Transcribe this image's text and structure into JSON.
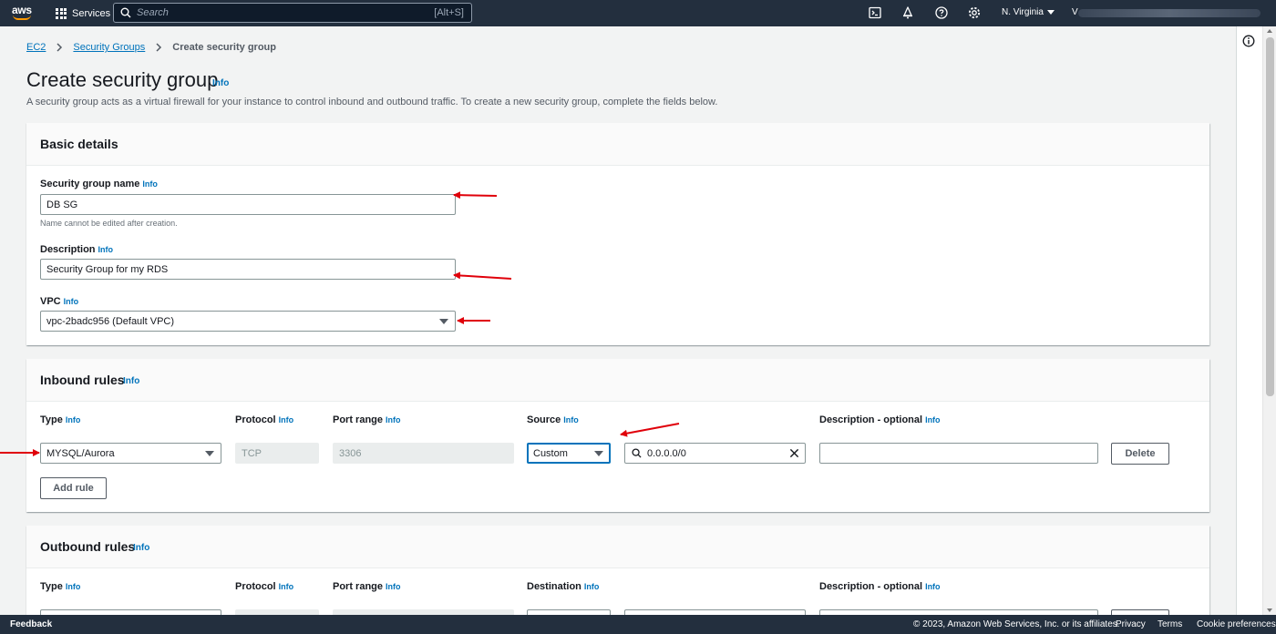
{
  "topbar": {
    "logo": "aws",
    "services_label": "Services",
    "search_placeholder": "Search",
    "search_shortcut": "[Alt+S]",
    "region": "N. Virginia",
    "account_initial": "V"
  },
  "breadcrumb": {
    "items": [
      "EC2",
      "Security Groups"
    ],
    "current": "Create security group"
  },
  "page": {
    "title": "Create security group",
    "title_info": "Info",
    "description": "A security group acts as a virtual firewall for your instance to control inbound and outbound traffic. To create a new security group, complete the fields below."
  },
  "basic": {
    "title": "Basic details",
    "name_label": "Security group name",
    "name_info": "Info",
    "name_value": "DB SG",
    "name_hint": "Name cannot be edited after creation.",
    "desc_label": "Description",
    "desc_info": "Info",
    "desc_value": "Security Group for my RDS",
    "vpc_label": "VPC",
    "vpc_info": "Info",
    "vpc_value": "vpc-2badc956 (Default VPC)"
  },
  "inbound": {
    "title": "Inbound rules",
    "title_info": "Info",
    "col_type": "Type",
    "col_protocol": "Protocol",
    "col_port": "Port range",
    "col_source": "Source",
    "col_desc": "Description - optional",
    "info": "Info",
    "type_value": "MYSQL/Aurora",
    "protocol_value": "TCP",
    "port_value": "3306",
    "source_select": "Custom",
    "source_cidr": "0.0.0.0/0",
    "description_value": "",
    "delete_label": "Delete",
    "add_rule_label": "Add rule"
  },
  "outbound": {
    "title": "Outbound rules",
    "title_info": "Info",
    "col_type": "Type",
    "col_protocol": "Protocol",
    "col_port": "Port range",
    "col_dest": "Destination",
    "col_desc": "Description - optional",
    "info": "Info"
  },
  "footer": {
    "feedback": "Feedback",
    "copyright": "© 2023, Amazon Web Services, Inc. or its affiliates.",
    "privacy": "Privacy",
    "terms": "Terms",
    "cookies": "Cookie preferences"
  },
  "colors": {
    "nav_bg": "#232f3e",
    "link": "#0073bb",
    "annotation_arrow": "#e0000a",
    "focus_border": "#0073bb"
  }
}
